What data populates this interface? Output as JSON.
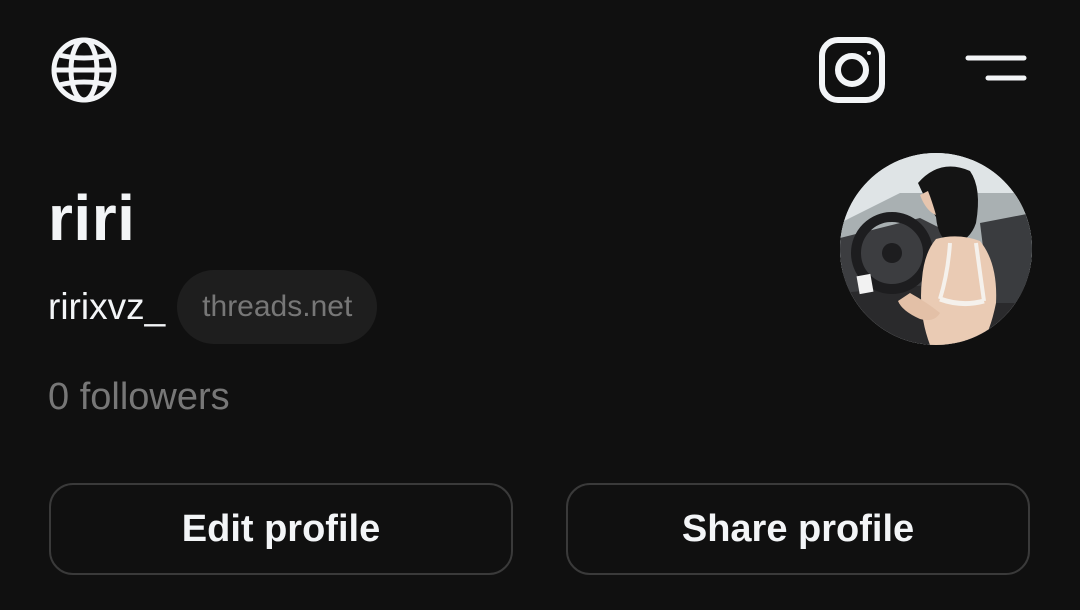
{
  "header": {
    "globe_icon": "globe-icon",
    "instagram_icon": "instagram-icon",
    "menu_icon": "menu-icon"
  },
  "profile": {
    "display_name": "riri",
    "handle": "ririxvz_",
    "domain_badge": "threads.net",
    "followers_text": "0 followers",
    "avatar": "profile-photo"
  },
  "actions": {
    "edit_label": "Edit profile",
    "share_label": "Share profile"
  },
  "colors": {
    "background": "#101010",
    "text_primary": "#f3f5f7",
    "text_secondary": "#777777",
    "pill_bg": "#1e1e1e",
    "button_border": "#3a3a3a"
  }
}
